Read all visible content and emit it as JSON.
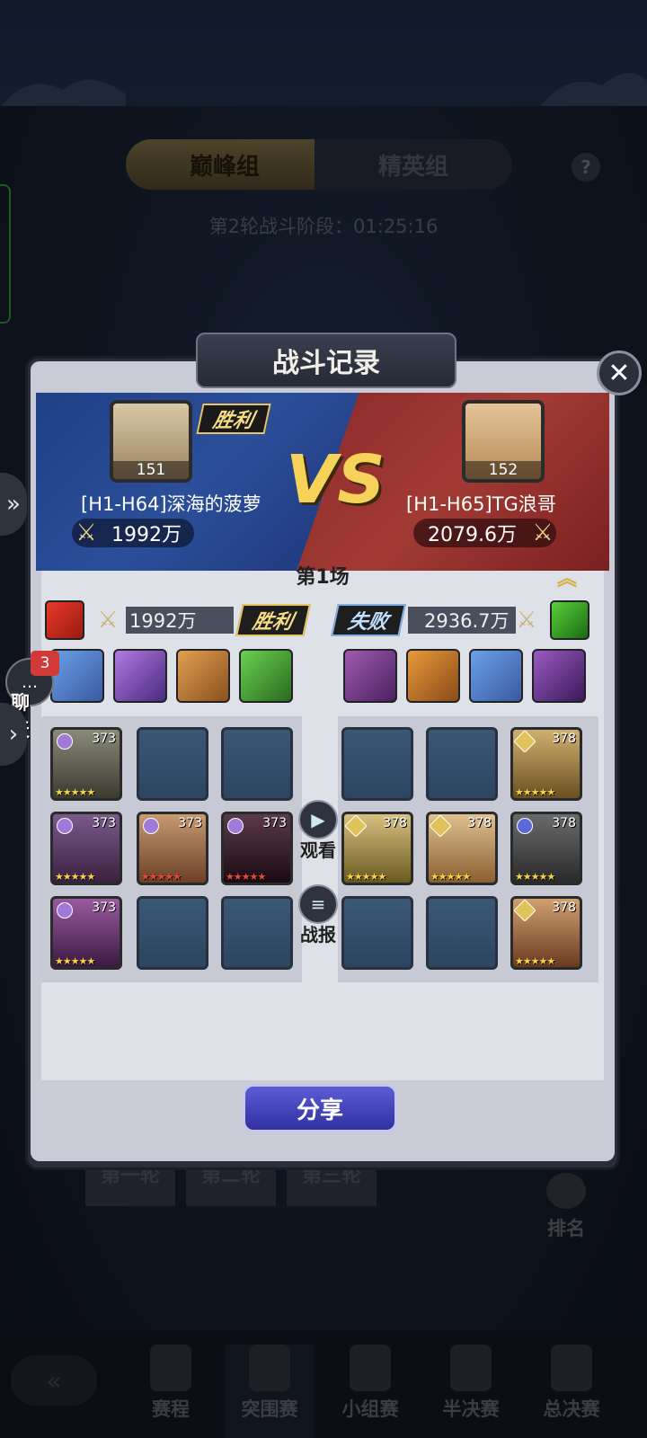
{
  "background": {
    "group_tabs": [
      {
        "label": "巅峰组",
        "active": true
      },
      {
        "label": "精英组",
        "active": false
      }
    ],
    "help_label": "?",
    "phase_text": "第2轮战斗阶段：01:25:16",
    "rounds": [
      "第一轮",
      "第二轮",
      "第三轮"
    ],
    "rank_label": "排名",
    "bottom_nav": [
      {
        "label": "赛程",
        "icon": "schedule-icon"
      },
      {
        "label": "突围赛",
        "icon": "breakout-icon",
        "active": true
      },
      {
        "label": "小组赛",
        "icon": "group-stage-icon"
      },
      {
        "label": "半决赛",
        "icon": "semifinal-icon"
      },
      {
        "label": "总决赛",
        "icon": "final-icon"
      }
    ]
  },
  "modal": {
    "title": "战斗记录",
    "close_symbol": "✕",
    "vs_text": "VS",
    "left_player": {
      "level": "151",
      "name": "[H1-H64]深海的菠萝",
      "power": "1992万",
      "result": "胜利"
    },
    "right_player": {
      "level": "152",
      "name": "[H1-H65]TG浪哥",
      "power": "2079.6万"
    },
    "match": {
      "title": "第1场",
      "collapse_symbol": "︽",
      "left": {
        "power": "1992万",
        "result": "胜利"
      },
      "right": {
        "power": "2936.7万",
        "result": "失败"
      },
      "left_heroes": [
        {
          "level": "373",
          "stars": "★★★★★",
          "star_color": "gold"
        },
        null,
        null,
        {
          "level": "373",
          "stars": "★★★★★",
          "star_color": "gold"
        },
        {
          "level": "373",
          "stars": "★★★★★",
          "star_color": "red"
        },
        {
          "level": "373",
          "stars": "★★★★★",
          "star_color": "red"
        },
        {
          "level": "373",
          "stars": "★★★★★",
          "star_color": "gold"
        },
        null,
        null
      ],
      "right_heroes": [
        null,
        null,
        {
          "level": "378",
          "stars": "★★★★★",
          "star_color": "gold"
        },
        {
          "level": "378",
          "stars": "★★★★★",
          "star_color": "gold"
        },
        {
          "level": "378",
          "stars": "★★★★★",
          "star_color": "gold"
        },
        {
          "level": "378",
          "stars": "★★★★★",
          "star_color": "gold"
        },
        null,
        null,
        {
          "level": "378",
          "stars": "★★★★★",
          "star_color": "gold"
        }
      ]
    },
    "watch_label": "观看",
    "report_label": "战报",
    "share_label": "分享"
  },
  "chat": {
    "label": "聊天",
    "badge": "3"
  },
  "colors": {
    "accent_gold": "#e8c463",
    "victory_blue": "#2c4f9a",
    "defeat_red": "#a23a34",
    "share_purple": "#4a4ac0"
  }
}
